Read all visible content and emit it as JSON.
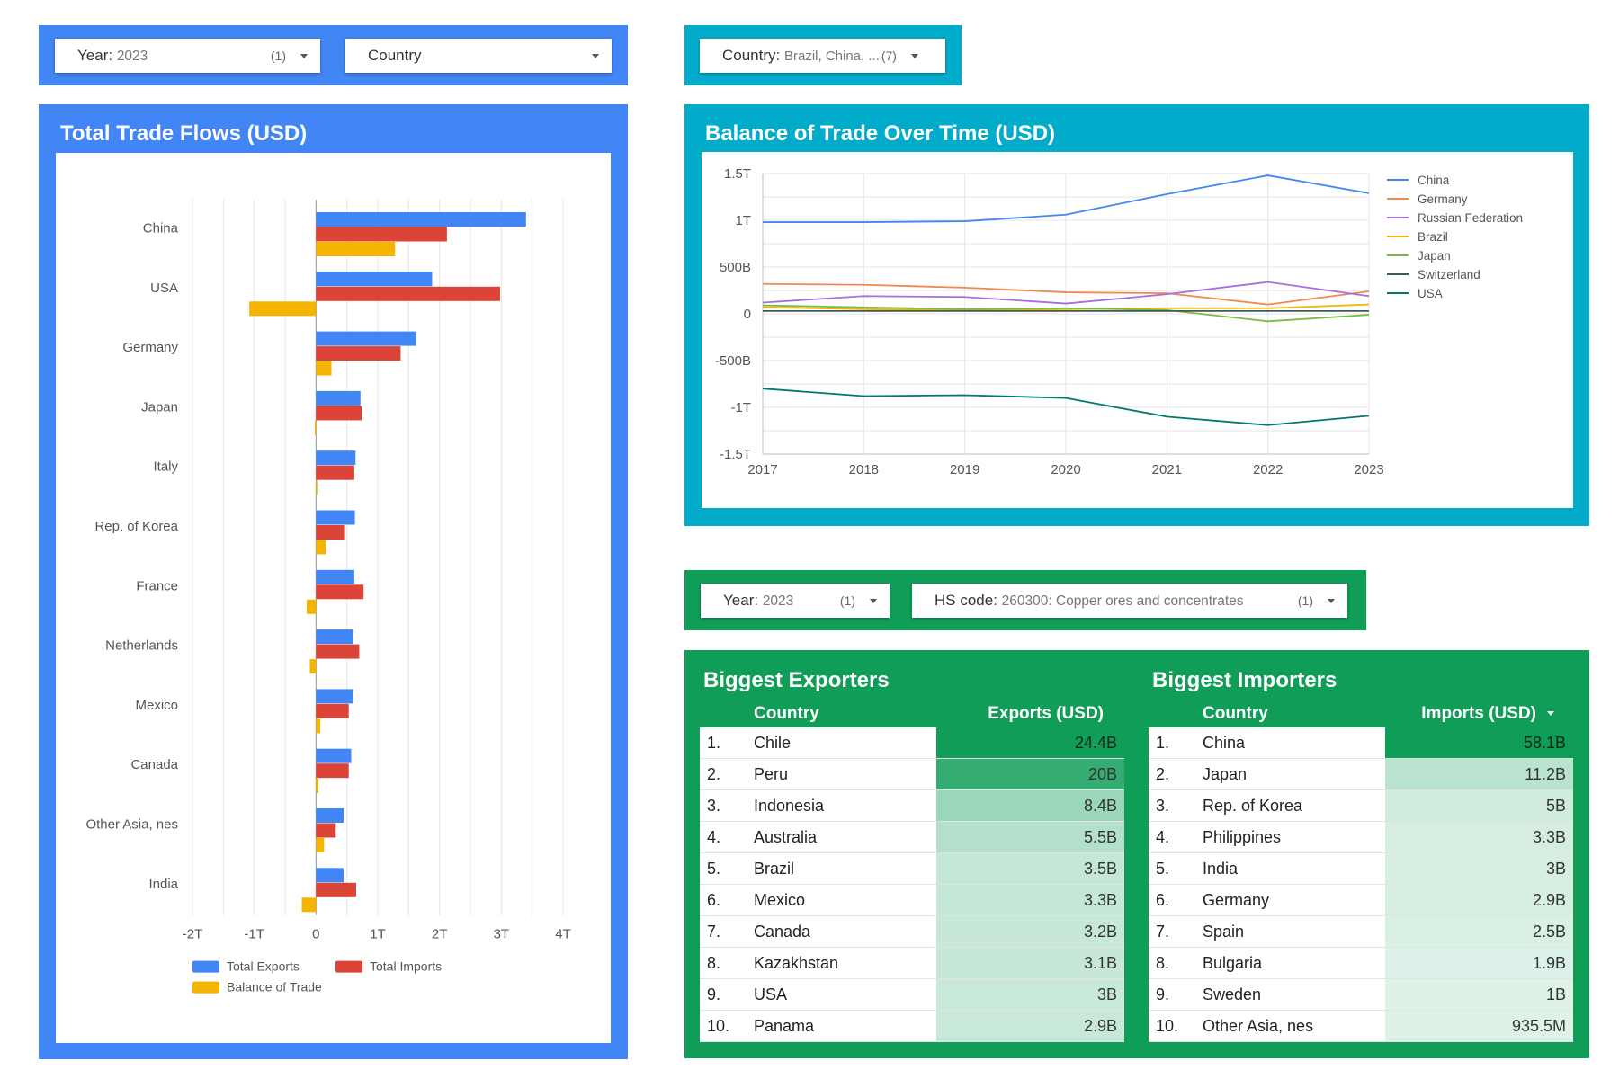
{
  "filters": {
    "left_year": {
      "label": "Year",
      "value": "2023",
      "count": "(1)"
    },
    "left_country": {
      "label": "Country"
    },
    "right_country": {
      "label": "Country",
      "value": "Brazil, China, ...",
      "count": "(7)"
    },
    "bottom_year": {
      "label": "Year",
      "value": "2023",
      "count": "(1)"
    },
    "bottom_hs": {
      "label": "HS code",
      "value": "260300: Copper ores and concentrates",
      "count": "(1)"
    }
  },
  "colors": {
    "blue_panel": "#4285f4",
    "teal_panel": "#00acc9",
    "green_panel": "#0f9d58",
    "exports": "#4285f4",
    "imports": "#db4437",
    "balance": "#f4b400"
  },
  "trade_flows": {
    "title": "Total Trade Flows (USD)"
  },
  "balance_over_time": {
    "title": "Balance of Trade Over Time (USD)"
  },
  "chart_data": [
    {
      "type": "bar",
      "orientation": "horizontal",
      "title": "Total Trade Flows (USD)",
      "categories": [
        "China",
        "USA",
        "Germany",
        "Japan",
        "Italy",
        "Rep. of Korea",
        "France",
        "Netherlands",
        "Mexico",
        "Canada",
        "Other Asia, nes",
        "India"
      ],
      "series": [
        {
          "name": "Total Exports",
          "color": "#4285f4",
          "values": [
            3.4,
            1.88,
            1.62,
            0.72,
            0.64,
            0.63,
            0.62,
            0.6,
            0.6,
            0.57,
            0.45,
            0.45
          ]
        },
        {
          "name": "Total Imports",
          "color": "#db4437",
          "values": [
            2.12,
            2.98,
            1.37,
            0.74,
            0.62,
            0.47,
            0.77,
            0.7,
            0.53,
            0.53,
            0.32,
            0.65
          ]
        },
        {
          "name": "Balance of Trade",
          "color": "#f4b400",
          "values": [
            1.28,
            -1.08,
            0.25,
            -0.02,
            0.02,
            0.16,
            -0.15,
            -0.1,
            0.07,
            0.04,
            0.13,
            -0.23
          ]
        }
      ],
      "xlim": [
        -2,
        4
      ],
      "xticks": [
        "-2T",
        "-1T",
        "0",
        "1T",
        "2T",
        "3T",
        "4T"
      ],
      "xtick_values": [
        -2,
        -1,
        0,
        1,
        2,
        3,
        4
      ],
      "legend": "bottom",
      "grid": true
    },
    {
      "type": "line",
      "title": "Balance of Trade Over Time (USD)",
      "x": [
        2017,
        2018,
        2019,
        2020,
        2021,
        2022,
        2023
      ],
      "series": [
        {
          "name": "China",
          "color": "#4285f4",
          "values": [
            0.98,
            0.98,
            0.99,
            1.06,
            1.28,
            1.48,
            1.29
          ]
        },
        {
          "name": "Germany",
          "color": "#f0894d",
          "values": [
            0.32,
            0.31,
            0.28,
            0.23,
            0.22,
            0.1,
            0.24
          ]
        },
        {
          "name": "Russian Federation",
          "color": "#a66ee0",
          "values": [
            0.12,
            0.19,
            0.18,
            0.11,
            0.21,
            0.34,
            0.19
          ]
        },
        {
          "name": "Brazil",
          "color": "#f4b400",
          "values": [
            0.07,
            0.05,
            0.04,
            0.05,
            0.06,
            0.06,
            0.1
          ]
        },
        {
          "name": "Japan",
          "color": "#7cbb42",
          "values": [
            0.09,
            0.07,
            0.05,
            0.06,
            0.04,
            -0.08,
            -0.01
          ]
        },
        {
          "name": "Switzerland",
          "color": "#3c5a5a",
          "values": [
            0.03,
            0.03,
            0.03,
            0.03,
            0.03,
            0.03,
            0.03
          ]
        },
        {
          "name": "USA",
          "color": "#00796b",
          "values": [
            -0.8,
            -0.88,
            -0.87,
            -0.9,
            -1.1,
            -1.19,
            -1.09
          ]
        }
      ],
      "ylim": [
        -1.5,
        1.5
      ],
      "yticks": [
        "1.5T",
        "1T",
        "500B",
        "0",
        "-500B",
        "-1T",
        "-1.5T"
      ],
      "ytick_values": [
        1.5,
        1.0,
        0.5,
        0,
        -0.5,
        -1.0,
        -1.5
      ],
      "legend": "right",
      "grid": true
    },
    {
      "type": "table",
      "title": "Biggest Exporters",
      "columns": [
        "Country",
        "Exports (USD)"
      ],
      "rows": [
        {
          "rank": "1.",
          "country": "Chile",
          "value": "24.4B",
          "shade": 1.0
        },
        {
          "rank": "2.",
          "country": "Peru",
          "value": "20B",
          "shade": 0.82
        },
        {
          "rank": "3.",
          "country": "Indonesia",
          "value": "8.4B",
          "shade": 0.34
        },
        {
          "rank": "4.",
          "country": "Australia",
          "value": "5.5B",
          "shade": 0.22
        },
        {
          "rank": "5.",
          "country": "Brazil",
          "value": "3.5B",
          "shade": 0.14
        },
        {
          "rank": "6.",
          "country": "Mexico",
          "value": "3.3B",
          "shade": 0.14
        },
        {
          "rank": "7.",
          "country": "Canada",
          "value": "3.2B",
          "shade": 0.13
        },
        {
          "rank": "8.",
          "country": "Kazakhstan",
          "value": "3.1B",
          "shade": 0.13
        },
        {
          "rank": "9.",
          "country": "USA",
          "value": "3B",
          "shade": 0.12
        },
        {
          "rank": "10.",
          "country": "Panama",
          "value": "2.9B",
          "shade": 0.12
        }
      ]
    },
    {
      "type": "table",
      "title": "Biggest Importers",
      "columns": [
        "Country",
        "Imports (USD)"
      ],
      "rows": [
        {
          "rank": "1.",
          "country": "China",
          "value": "58.1B",
          "shade": 1.0
        },
        {
          "rank": "2.",
          "country": "Japan",
          "value": "11.2B",
          "shade": 0.19
        },
        {
          "rank": "3.",
          "country": "Rep. of Korea",
          "value": "5B",
          "shade": 0.09
        },
        {
          "rank": "4.",
          "country": "Philippines",
          "value": "3.3B",
          "shade": 0.06
        },
        {
          "rank": "5.",
          "country": "India",
          "value": "3B",
          "shade": 0.05
        },
        {
          "rank": "6.",
          "country": "Germany",
          "value": "2.9B",
          "shade": 0.05
        },
        {
          "rank": "7.",
          "country": "Spain",
          "value": "2.5B",
          "shade": 0.04
        },
        {
          "rank": "8.",
          "country": "Bulgaria",
          "value": "1.9B",
          "shade": 0.03
        },
        {
          "rank": "9.",
          "country": "Sweden",
          "value": "1B",
          "shade": 0.02
        },
        {
          "rank": "10.",
          "country": "Other Asia, nes",
          "value": "935.5M",
          "shade": 0.02
        }
      ]
    }
  ]
}
